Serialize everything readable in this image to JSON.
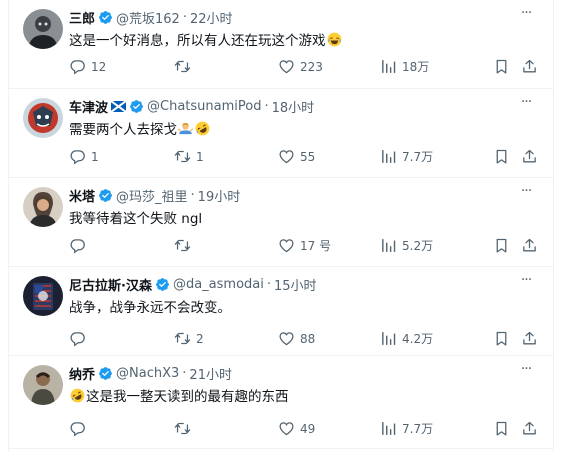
{
  "tweets": [
    {
      "name": "三郎",
      "flag": "",
      "handle": "@荒坂162",
      "time": "22小时",
      "text": "这是一个好消息，所以有人还在玩这个游戏",
      "emoji_after": "face-with-tears-of-joy",
      "replies": "12",
      "retweets": "",
      "likes": "223",
      "views": "18万"
    },
    {
      "name": "车津波",
      "flag": "🏴",
      "handle": "@ChatsunamiPod",
      "time": "18小时",
      "text": "需要两个人去探戈",
      "emoji_after": "man-shrugging rolling-on-floor-laughing",
      "replies": "1",
      "retweets": "1",
      "likes": "55",
      "views": "7.7万"
    },
    {
      "name": "米塔",
      "flag": "",
      "handle": "@玛莎_祖里",
      "time": "19小时",
      "text": "我等待着这个失败 ngl",
      "emoji_after": "",
      "replies": "",
      "retweets": "",
      "likes": "17 号",
      "views": "5.2万"
    },
    {
      "name": "尼古拉斯·汉森",
      "flag": "",
      "handle": "@da_asmodai",
      "time": "15小时",
      "text": "战争，战争永远不会改变。",
      "emoji_after": "",
      "replies": "",
      "retweets": "2",
      "likes": "88",
      "views": "4.2万"
    },
    {
      "name": "纳乔",
      "flag": "",
      "handle": "@NachX3",
      "time": "21小时",
      "text": "这是我一整天读到的最有趣的东西",
      "emoji_before": "rolling-on-floor-laughing",
      "replies": "",
      "retweets": "",
      "likes": "49",
      "views": "7.7万"
    }
  ],
  "separator": "·",
  "colors": {
    "verified": "#1d9bf0",
    "muted": "#536471",
    "text": "#0f1419",
    "divider": "#eff3f4"
  }
}
